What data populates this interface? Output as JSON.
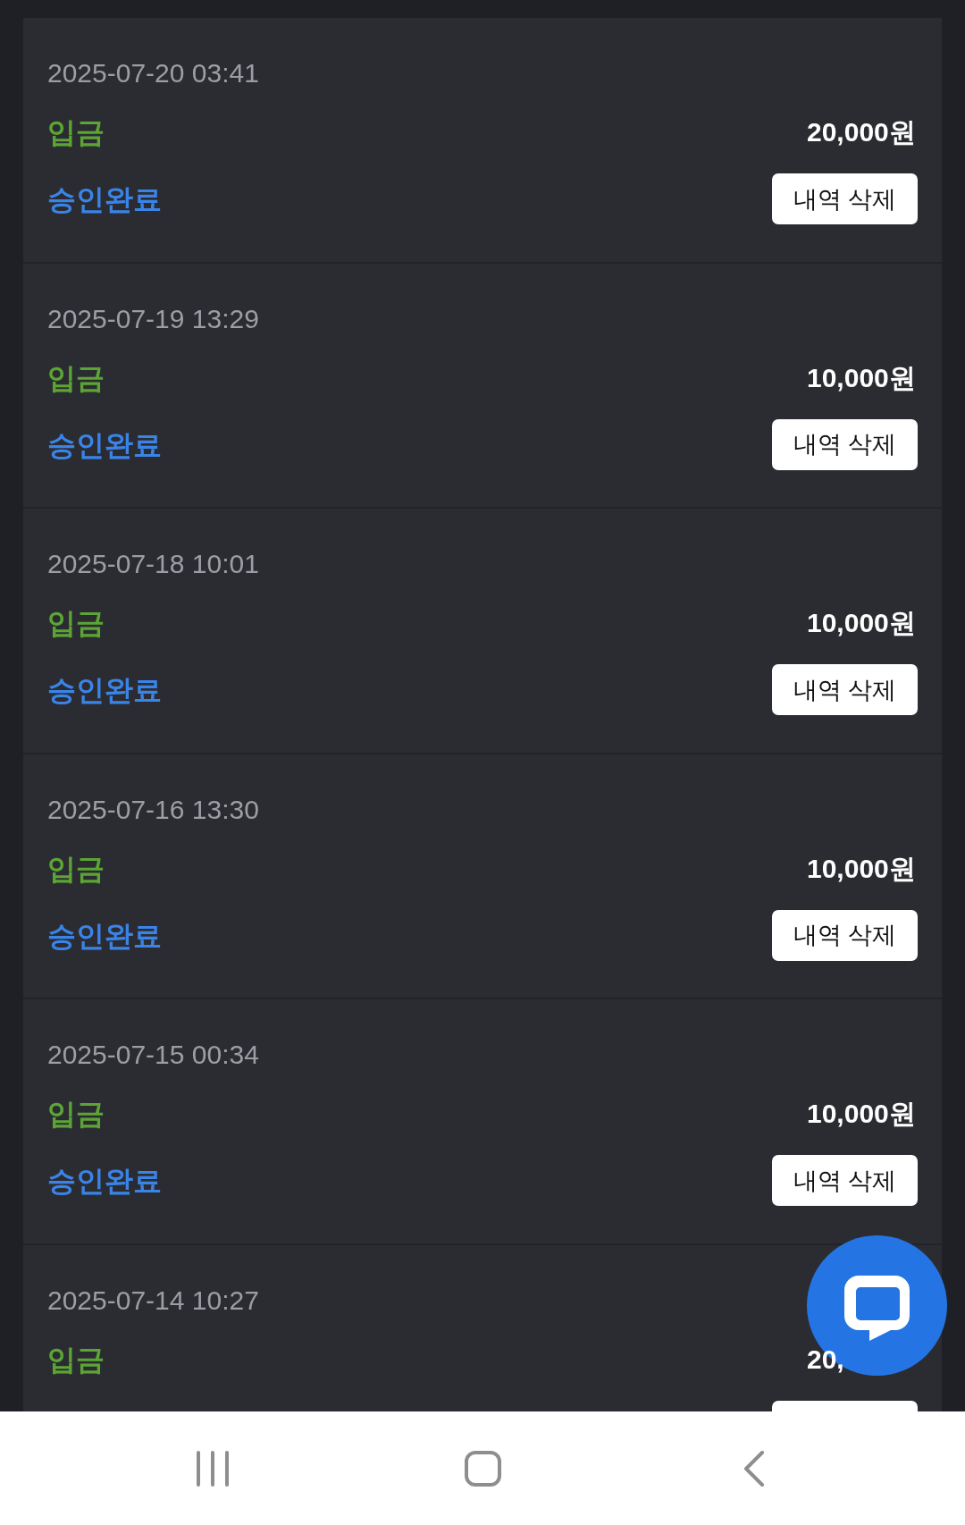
{
  "transactions": [
    {
      "date": "2025-07-20 03:41",
      "type": "입금",
      "amount": "20,000원",
      "status": "승인완료",
      "delete_button": {
        "label": "내역 삭제",
        "partly_hidden": false
      }
    },
    {
      "date": "2025-07-19 13:29",
      "type": "입금",
      "amount": "10,000원",
      "status": "승인완료",
      "delete_button": {
        "label": "내역 삭제",
        "partly_hidden": false
      }
    },
    {
      "date": "2025-07-18 10:01",
      "type": "입금",
      "amount": "10,000원",
      "status": "승인완료",
      "delete_button": {
        "label": "내역 삭제",
        "partly_hidden": false
      }
    },
    {
      "date": "2025-07-16 13:30",
      "type": "입금",
      "amount": "10,000원",
      "status": "승인완료",
      "delete_button": {
        "label": "내역 삭제",
        "partly_hidden": false
      }
    },
    {
      "date": "2025-07-15 00:34",
      "type": "입금",
      "amount": "10,000원",
      "status": "승인완료",
      "delete_button": {
        "label": "내역 삭제",
        "partly_hidden": false
      }
    },
    {
      "date": "2025-07-14 10:27",
      "type": "입금",
      "amount": "20,",
      "delete_button": {
        "partly_hidden": true
      }
    }
  ]
}
